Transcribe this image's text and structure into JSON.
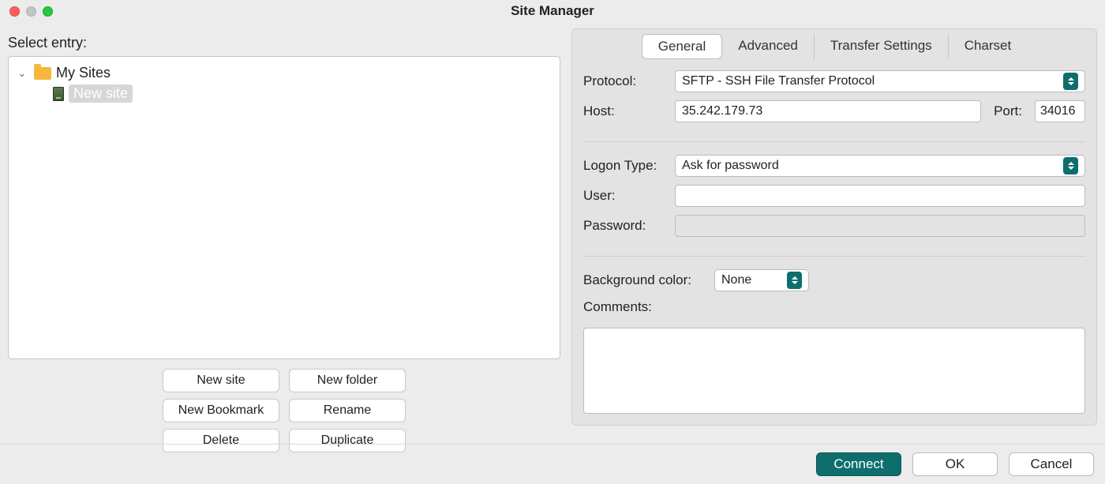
{
  "window": {
    "title": "Site Manager"
  },
  "left": {
    "select_label": "Select entry:",
    "tree": {
      "root": "My Sites",
      "selected": "New site"
    },
    "buttons": {
      "new_site": "New site",
      "new_folder": "New folder",
      "new_bookmark": "New Bookmark",
      "rename": "Rename",
      "delete": "Delete",
      "duplicate": "Duplicate"
    }
  },
  "tabs": {
    "general": "General",
    "advanced": "Advanced",
    "transfer": "Transfer Settings",
    "charset": "Charset"
  },
  "form": {
    "protocol_label": "Protocol:",
    "protocol_value": "SFTP - SSH File Transfer Protocol",
    "host_label": "Host:",
    "host_value": "35.242.179.73",
    "port_label": "Port:",
    "port_value": "34016",
    "logon_label": "Logon Type:",
    "logon_value": "Ask for password",
    "user_label": "User:",
    "user_value": "",
    "password_label": "Password:",
    "password_value": "",
    "bgcolor_label": "Background color:",
    "bgcolor_value": "None",
    "comments_label": "Comments:",
    "comments_value": ""
  },
  "footer": {
    "connect": "Connect",
    "ok": "OK",
    "cancel": "Cancel"
  }
}
